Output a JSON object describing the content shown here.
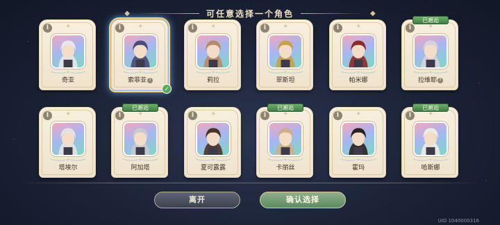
{
  "header": {
    "title": "可任意选择一个角色"
  },
  "characters_row1": [
    {
      "name": "奇亚",
      "badge": "",
      "help": false,
      "selected": false,
      "hair": "#e8e6ec"
    },
    {
      "name": "索菲亚",
      "badge": "",
      "help": true,
      "selected": true,
      "hair": "#4b4a78"
    },
    {
      "name": "莉拉",
      "badge": "",
      "help": false,
      "selected": false,
      "hair": "#b98a6a"
    },
    {
      "name": "翠斯坦",
      "badge": "",
      "help": false,
      "selected": false,
      "hair": "#c8a04a"
    },
    {
      "name": "帕米娜",
      "badge": "",
      "help": false,
      "selected": false,
      "hair": "#8e2a24"
    },
    {
      "name": "拉维耶",
      "badge": "已邂逅",
      "help": true,
      "selected": false,
      "hair": "#d8d0dc"
    }
  ],
  "characters_row2": [
    {
      "name": "塔埃尔",
      "badge": "",
      "help": false,
      "selected": false,
      "hair": "#e2e2e6"
    },
    {
      "name": "阿加塔",
      "badge": "已邂逅",
      "help": false,
      "selected": false,
      "hair": "#c9c9cf"
    },
    {
      "name": "夏可露露",
      "badge": "",
      "help": false,
      "selected": false,
      "hair": "#4a3328"
    },
    {
      "name": "卡丽丝",
      "badge": "已邂逅",
      "help": false,
      "selected": false,
      "hair": "#cdb08a"
    },
    {
      "name": "霍玛",
      "badge": "",
      "help": false,
      "selected": false,
      "hair": "#2a2220"
    },
    {
      "name": "哈斯娜",
      "badge": "已邂逅",
      "help": false,
      "selected": false,
      "hair": "#ecece6"
    }
  ],
  "buttons": {
    "leave": "离开",
    "confirm": "确认选择"
  },
  "footer": {
    "uid": "UID 1040000316"
  },
  "icons": {
    "info": "i",
    "help": "?",
    "check": "✓",
    "sparkle": "✦"
  }
}
